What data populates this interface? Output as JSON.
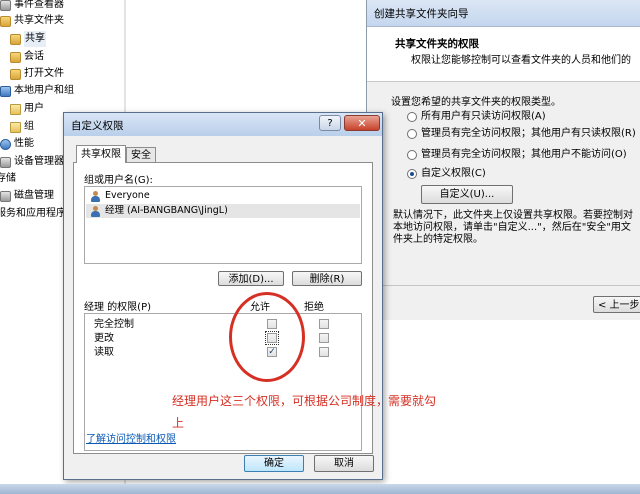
{
  "tree": {
    "items": [
      {
        "label": "事件查看器",
        "icon": "event-viewer-icon"
      },
      {
        "label": "共享文件夹",
        "icon": "shared-folders-icon"
      },
      {
        "label": "共享",
        "icon": "shares-icon"
      },
      {
        "label": "会话",
        "icon": "sessions-icon"
      },
      {
        "label": "打开文件",
        "icon": "open-files-icon"
      },
      {
        "label": "本地用户和组",
        "icon": "local-users-groups-icon"
      },
      {
        "label": "用户",
        "icon": "folder-icon"
      },
      {
        "label": "组",
        "icon": "folder-icon"
      },
      {
        "label": "性能",
        "icon": "performance-icon"
      },
      {
        "label": "设备管理器",
        "icon": "device-manager-icon"
      },
      {
        "label": "存储",
        "icon": ""
      },
      {
        "label": "磁盘管理",
        "icon": "disk-management-icon"
      },
      {
        "label": "服务和应用程序",
        "icon": ""
      }
    ]
  },
  "wizard": {
    "title": "创建共享文件夹向导",
    "header_title": "共享文件夹的权限",
    "header_subtitle": "权限让您能够控制可以查看文件夹的人员和他们的",
    "prompt": "设置您希望的共享文件夹的权限类型。",
    "options": [
      {
        "label": "所有用户有只读访问权限(A)",
        "selected": false
      },
      {
        "label": "管理员有完全访问权限；其他用户有只读权限(R)",
        "selected": false
      },
      {
        "label": "管理员有完全访问权限；其他用户不能访问(O)",
        "selected": false
      },
      {
        "label": "自定义权限(C)",
        "selected": true
      }
    ],
    "custom_button": "自定义(U)...",
    "note": "默认情况下，此文件夹上仅设置共享权限。若要控制对本地访问权限，请单击\"自定义...\"，然后在\"安全\"用文件夹上的特定权限。",
    "back_button": "< 上一步"
  },
  "dialog": {
    "title": "自定义权限",
    "help": "?",
    "close": "✕",
    "tabs": [
      "共享权限",
      "安全"
    ],
    "group_label": "组或用户名(G):",
    "users": [
      {
        "name": "Everyone",
        "selected": false
      },
      {
        "name": "经理 (AI-BANGBANG\\JingL)",
        "selected": true
      }
    ],
    "add_button": "添加(D)...",
    "remove_button": "删除(R)",
    "perm_label": "经理 的权限(P)",
    "allow_header": "允许",
    "deny_header": "拒绝",
    "permissions": [
      {
        "name": "完全控制",
        "allow": false,
        "deny": false
      },
      {
        "name": "更改",
        "allow": false,
        "deny": false
      },
      {
        "name": "读取",
        "allow": true,
        "deny": false
      }
    ],
    "link": "了解访问控制和权限",
    "ok_button": "确定",
    "cancel_button": "取消"
  },
  "annotation": {
    "text": "经理用户这三个权限，可根据公司制度，需要就勾上",
    "color": "#d63024"
  },
  "colors": {
    "title_bar": "#c4d6ee",
    "dialog_bg": "#f0f0f0",
    "link": "#0b59b5"
  }
}
